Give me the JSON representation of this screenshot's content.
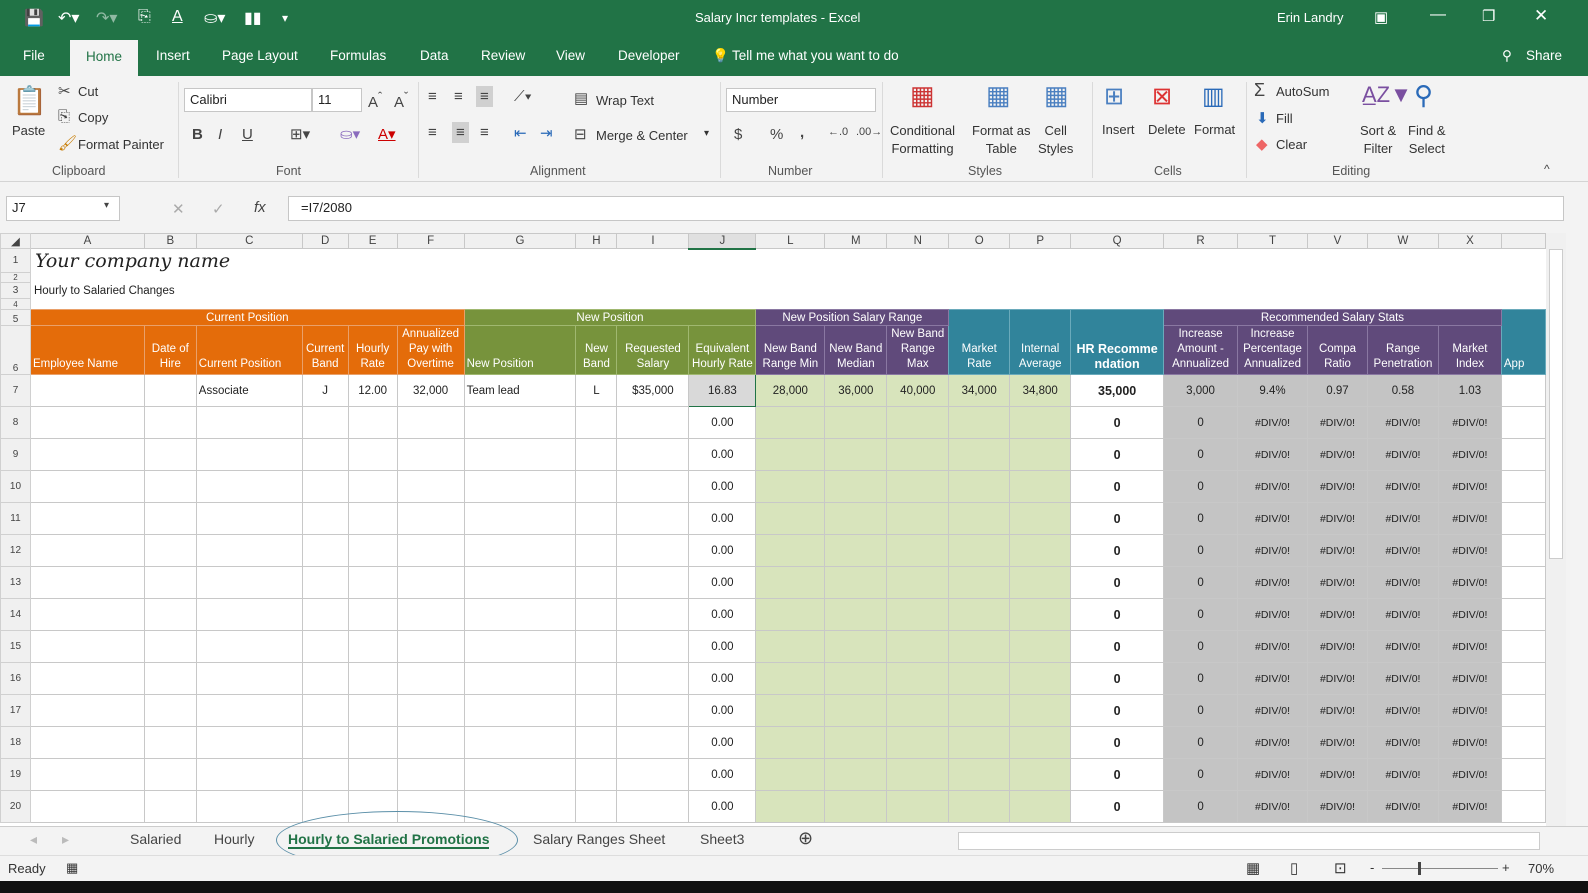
{
  "window": {
    "title": "Salary Incr templates  -  Excel",
    "user": "Erin Landry",
    "share": "Share"
  },
  "menu": {
    "tabs": [
      "File",
      "Home",
      "Insert",
      "Page Layout",
      "Formulas",
      "Data",
      "Review",
      "View",
      "Developer"
    ],
    "tell_me": "Tell me what you want to do"
  },
  "ribbon": {
    "clipboard": {
      "paste": "Paste",
      "cut": "Cut",
      "copy": "Copy",
      "format_painter": "Format Painter",
      "label": "Clipboard"
    },
    "font": {
      "name": "Calibri",
      "size": "11",
      "bold": "B",
      "italic": "I",
      "underline": "U",
      "label": "Font"
    },
    "alignment": {
      "wrap": "Wrap Text",
      "merge": "Merge & Center",
      "label": "Alignment"
    },
    "number": {
      "format": "Number",
      "currency": "$",
      "percent": "%",
      "comma": ",",
      "label": "Number"
    },
    "styles": {
      "conditional": "Conditional\nFormatting",
      "format_table": "Format as\nTable",
      "cell_styles": "Cell\nStyles",
      "label": "Styles"
    },
    "cells": {
      "insert": "Insert",
      "delete": "Delete",
      "format": "Format",
      "label": "Cells"
    },
    "editing": {
      "autosum": "AutoSum",
      "fill": "Fill",
      "clear": "Clear",
      "sort": "Sort &\nFilter",
      "find": "Find &\nSelect",
      "label": "Editing"
    }
  },
  "formula_bar": {
    "name_box": "J7",
    "fx": "fx",
    "formula": "=I7/2080"
  },
  "sheet": {
    "columns": [
      "A",
      "B",
      "C",
      "D",
      "E",
      "F",
      "G",
      "H",
      "I",
      "J",
      "L",
      "M",
      "N",
      "O",
      "P",
      "Q",
      "R",
      "T",
      "V",
      "W",
      "X",
      ""
    ],
    "company": "Your company name",
    "subtitle": "Hourly to Salaried Changes",
    "groups": {
      "current": "Current Position",
      "new": "New Position",
      "range": "New Position Salary Range",
      "stats": "Recommended Salary Stats"
    },
    "headers": [
      "Employee Name",
      "Date of Hire",
      "Current Position",
      "Current Band",
      "Hourly Rate",
      "Annualized Pay with Overtime",
      "New Position",
      "New Band",
      "Requested Salary",
      "Equivalent Hourly Rate",
      "New Band Range Min",
      "New Band Median",
      "New Band Range Max",
      "Market Rate",
      "Internal Average",
      "HR Recommendation",
      "Increase Amount - Annualized",
      "Increase Percentage Annualized",
      "Compa Ratio",
      "Range Penetration",
      "Market Index",
      "App"
    ],
    "rows": [
      {
        "n": "7",
        "cells": [
          "",
          "",
          "Associate",
          "J",
          "12.00",
          "32,000",
          "Team lead",
          "L",
          "$35,000",
          "16.83",
          "28,000",
          "36,000",
          "40,000",
          "34,000",
          "34,800",
          "35,000",
          "3,000",
          "9.4%",
          "0.97",
          "0.58",
          "1.03",
          ""
        ]
      },
      {
        "n": "8",
        "cells": [
          "",
          "",
          "",
          "",
          "",
          "",
          "",
          "",
          "",
          "0.00",
          "",
          "",
          "",
          "",
          "",
          "0",
          "0",
          "#DIV/0!",
          "#DIV/0!",
          "#DIV/0!",
          "#DIV/0!",
          ""
        ]
      },
      {
        "n": "9",
        "cells": [
          "",
          "",
          "",
          "",
          "",
          "",
          "",
          "",
          "",
          "0.00",
          "",
          "",
          "",
          "",
          "",
          "0",
          "0",
          "#DIV/0!",
          "#DIV/0!",
          "#DIV/0!",
          "#DIV/0!",
          ""
        ]
      },
      {
        "n": "10",
        "cells": [
          "",
          "",
          "",
          "",
          "",
          "",
          "",
          "",
          "",
          "0.00",
          "",
          "",
          "",
          "",
          "",
          "0",
          "0",
          "#DIV/0!",
          "#DIV/0!",
          "#DIV/0!",
          "#DIV/0!",
          ""
        ]
      },
      {
        "n": "11",
        "cells": [
          "",
          "",
          "",
          "",
          "",
          "",
          "",
          "",
          "",
          "0.00",
          "",
          "",
          "",
          "",
          "",
          "0",
          "0",
          "#DIV/0!",
          "#DIV/0!",
          "#DIV/0!",
          "#DIV/0!",
          ""
        ]
      },
      {
        "n": "12",
        "cells": [
          "",
          "",
          "",
          "",
          "",
          "",
          "",
          "",
          "",
          "0.00",
          "",
          "",
          "",
          "",
          "",
          "0",
          "0",
          "#DIV/0!",
          "#DIV/0!",
          "#DIV/0!",
          "#DIV/0!",
          ""
        ]
      },
      {
        "n": "13",
        "cells": [
          "",
          "",
          "",
          "",
          "",
          "",
          "",
          "",
          "",
          "0.00",
          "",
          "",
          "",
          "",
          "",
          "0",
          "0",
          "#DIV/0!",
          "#DIV/0!",
          "#DIV/0!",
          "#DIV/0!",
          ""
        ]
      },
      {
        "n": "14",
        "cells": [
          "",
          "",
          "",
          "",
          "",
          "",
          "",
          "",
          "",
          "0.00",
          "",
          "",
          "",
          "",
          "",
          "0",
          "0",
          "#DIV/0!",
          "#DIV/0!",
          "#DIV/0!",
          "#DIV/0!",
          ""
        ]
      },
      {
        "n": "15",
        "cells": [
          "",
          "",
          "",
          "",
          "",
          "",
          "",
          "",
          "",
          "0.00",
          "",
          "",
          "",
          "",
          "",
          "0",
          "0",
          "#DIV/0!",
          "#DIV/0!",
          "#DIV/0!",
          "#DIV/0!",
          ""
        ]
      },
      {
        "n": "16",
        "cells": [
          "",
          "",
          "",
          "",
          "",
          "",
          "",
          "",
          "",
          "0.00",
          "",
          "",
          "",
          "",
          "",
          "0",
          "0",
          "#DIV/0!",
          "#DIV/0!",
          "#DIV/0!",
          "#DIV/0!",
          ""
        ]
      },
      {
        "n": "17",
        "cells": [
          "",
          "",
          "",
          "",
          "",
          "",
          "",
          "",
          "",
          "0.00",
          "",
          "",
          "",
          "",
          "",
          "0",
          "0",
          "#DIV/0!",
          "#DIV/0!",
          "#DIV/0!",
          "#DIV/0!",
          ""
        ]
      },
      {
        "n": "18",
        "cells": [
          "",
          "",
          "",
          "",
          "",
          "",
          "",
          "",
          "",
          "0.00",
          "",
          "",
          "",
          "",
          "",
          "0",
          "0",
          "#DIV/0!",
          "#DIV/0!",
          "#DIV/0!",
          "#DIV/0!",
          ""
        ]
      },
      {
        "n": "19",
        "cells": [
          "",
          "",
          "",
          "",
          "",
          "",
          "",
          "",
          "",
          "0.00",
          "",
          "",
          "",
          "",
          "",
          "0",
          "0",
          "#DIV/0!",
          "#DIV/0!",
          "#DIV/0!",
          "#DIV/0!",
          ""
        ]
      },
      {
        "n": "20",
        "cells": [
          "",
          "",
          "",
          "",
          "",
          "",
          "",
          "",
          "",
          "0.00",
          "",
          "",
          "",
          "",
          "",
          "0",
          "0",
          "#DIV/0!",
          "#DIV/0!",
          "#DIV/0!",
          "#DIV/0!",
          ""
        ]
      }
    ],
    "header_row_numbers": [
      "1",
      "2",
      "3",
      "4",
      "5",
      "6"
    ]
  },
  "sheet_tabs": [
    "Salaried",
    "Hourly",
    "Hourly to Salaried Promotions",
    "Salary Ranges Sheet",
    "Sheet3"
  ],
  "active_tab": "Hourly to Salaried Promotions",
  "status": {
    "ready": "Ready",
    "zoom": "70%"
  },
  "colors": {
    "excel_green": "#217346",
    "orange": "#e46c0a",
    "green": "#77933c",
    "purple": "#604a7b",
    "teal": "#31849b",
    "light_green": "#d8e4bc",
    "grey": "#c4c4c4"
  }
}
